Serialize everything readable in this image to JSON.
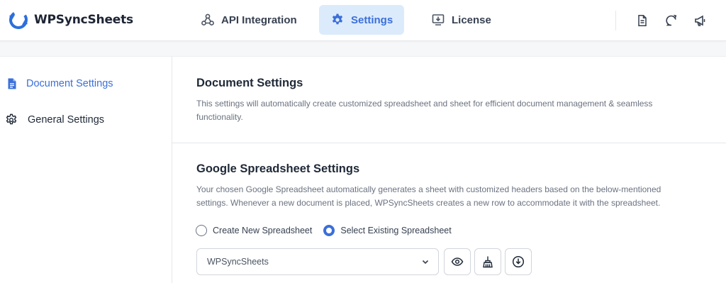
{
  "app": {
    "name": "WPSyncSheets"
  },
  "nav": {
    "api_integration": "API Integration",
    "settings": "Settings",
    "license": "License"
  },
  "top_icons": [
    "document-icon",
    "chat-refresh-icon",
    "megaphone-icon"
  ],
  "sidebar": {
    "items": [
      {
        "label": "Document Settings",
        "icon": "document-icon",
        "active": true
      },
      {
        "label": "General Settings",
        "icon": "gear-icon",
        "active": false
      }
    ]
  },
  "document_settings": {
    "title": "Document Settings",
    "description": "This settings will automatically create customized spreadsheet and sheet for efficient document management & seamless functionality."
  },
  "google_settings": {
    "title": "Google Spreadsheet Settings",
    "description": "Your chosen Google Spreadsheet automatically generates a sheet with customized headers based on the below-mentioned settings. Whenever a new document is placed, WPSyncSheets creates a new row to accommodate it with the spreadsheet.",
    "radio_create": "Create New Spreadsheet",
    "radio_select": "Select Existing Spreadsheet",
    "selected_radio": "select",
    "spreadsheet_value": "WPSyncSheets",
    "action_icons": [
      "eye-icon",
      "broom-icon",
      "download-icon"
    ]
  },
  "colors": {
    "accent": "#3b6fd9",
    "accent_bg": "#dcebfb"
  }
}
